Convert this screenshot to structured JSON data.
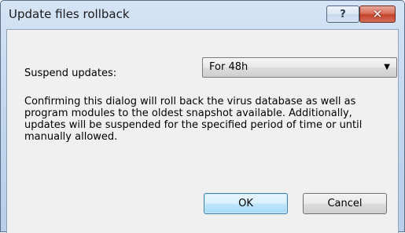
{
  "window": {
    "title": "Update files rollback",
    "help_glyph": "?",
    "close_glyph": "✕"
  },
  "form": {
    "suspend_label": "Suspend updates:",
    "suspend_selected": "For 48h"
  },
  "description": "Confirming this dialog will roll back the virus database as well as program modules to the oldest snapshot available. Additionally, updates will be suspended for the specified period of time or until manually allowed.",
  "buttons": {
    "ok_label": "OK",
    "cancel_label": "Cancel"
  },
  "icons": {
    "help": "help-icon",
    "close": "close-icon",
    "dropdown": "chevron-down-icon"
  }
}
